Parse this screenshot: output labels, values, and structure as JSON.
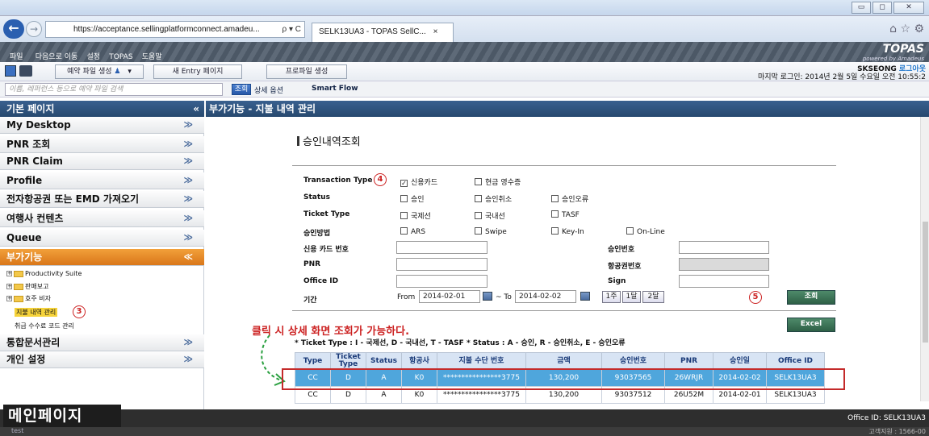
{
  "browser": {
    "url": "https://acceptance.sellingplatformconnect.amadeu...",
    "url_controls": "ρ ▾ C",
    "tab_title": "SELK13UA3 - TOPAS SellC...",
    "tab_close": "×"
  },
  "window": {
    "minimize": "▭",
    "maximize": "◻",
    "close": "✕"
  },
  "menu": {
    "items": [
      "파일",
      "다음으로 이동",
      "설정",
      "TOPAS",
      "도움말"
    ],
    "brand": "TOPAS",
    "brand_sub": "powered by Amadeus"
  },
  "toolbar": {
    "booking_create": "예약 파일 생성",
    "new_entry": "새 Entry 페이지",
    "profile_create": "프로파일 생성"
  },
  "user": {
    "name": "SKSEONG",
    "logout": "로그아웃",
    "last_login": "마지막 로그인: 2014년 2월 5일 수요일 오전 10:55:2"
  },
  "search": {
    "placeholder": "이름, 레퍼런스 등으로 예약 파일 검색",
    "search_button": "조회",
    "detail_option": "상세 옵션",
    "smart_flow": "Smart Flow"
  },
  "sidebar": {
    "header": "기본 페이지",
    "collapse": "«",
    "items": [
      {
        "label": "My Desktop"
      },
      {
        "label": "PNR 조회"
      },
      {
        "label": "PNR Claim"
      },
      {
        "label": "Profile"
      },
      {
        "label": "전자항공권 또는 EMD 가져오기"
      },
      {
        "label": "여행사 컨텐츠"
      },
      {
        "label": "Queue"
      },
      {
        "label": "부가기능"
      },
      {
        "label": "통합문서관리"
      },
      {
        "label": "개인 설정"
      }
    ],
    "tree": [
      "Productivity Suite",
      "판매보고",
      "호주 비자",
      "지불 내역 관리",
      "취급 수수료 코드 관리"
    ]
  },
  "content": {
    "header": "부가기능 - 지불 내역 관리",
    "section_title": "승인내역조회",
    "form": {
      "transaction_type_label": "Transaction Type",
      "tt_card": "신용카드",
      "tt_cash": "현금 영수증",
      "status_label": "Status",
      "st_approve": "승인",
      "st_cancel": "승인취소",
      "st_error": "승인오류",
      "ticket_type_label": "Ticket Type",
      "tk_intl": "국제선",
      "tk_dom": "국내선",
      "tk_tasf": "TASF",
      "method_label": "승인방법",
      "m_ars": "ARS",
      "m_swipe": "Swipe",
      "m_keyin": "Key-In",
      "m_online": "On-Line",
      "card_no_label": "신용 카드 번호",
      "approval_no_label": "승인번호",
      "pnr_label": "PNR",
      "ticket_no_label": "항공권번호",
      "office_id_label": "Office ID",
      "sign_label": "Sign",
      "period_label": "기간",
      "from_label": "From",
      "from_date": "2014-02-01",
      "to_label": "~ To",
      "to_date": "2014-02-02",
      "week": "1주",
      "month1": "1달",
      "month2": "2달",
      "search_button": "조회",
      "excel_button": "Excel"
    },
    "annotation": "클릭 시 상세 화면 조회가 가능하다.",
    "legend": "* Ticket Type : I - 국제선, D - 국내선, T - TASF    * Status : A - 승인, R - 승인취소, E - 승인오류",
    "markers": {
      "m3": "3",
      "m4": "4",
      "m5": "5"
    },
    "table": {
      "headers": [
        "Type",
        "Ticket Type",
        "Status",
        "항공사",
        "지불 수단 번호",
        "금액",
        "승인번호",
        "PNR",
        "승인일",
        "Office ID"
      ],
      "rows": [
        [
          "CC",
          "D",
          "A",
          "K0",
          "****************3775",
          "130,200",
          "93037565",
          "26WRJR",
          "2014-02-02",
          "SELK13UA3"
        ],
        [
          "CC",
          "D",
          "A",
          "K0",
          "****************3775",
          "130,200",
          "93037512",
          "26U52M",
          "2014-02-01",
          "SELK13UA3"
        ]
      ]
    }
  },
  "bottom": {
    "main_page": "메인페이지",
    "office_id": "Office ID: SELK13UA3",
    "status_text": "test",
    "customer_center": "고객지원 : 1566-00"
  },
  "colors": {
    "header_blue": "#2f5682",
    "active_orange": "#e5862a",
    "selected_row": "#4fa6dc",
    "annotation_red": "#c42a2a"
  }
}
